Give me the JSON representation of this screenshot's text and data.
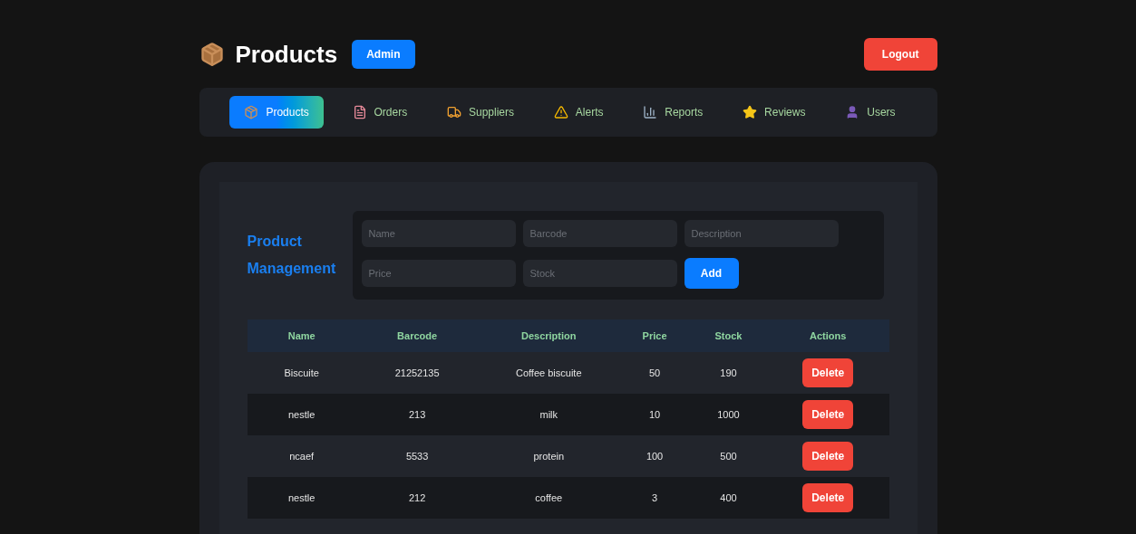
{
  "header": {
    "title": "Products",
    "role_badge": "Admin",
    "logout": "Logout"
  },
  "nav": [
    {
      "label": "Products",
      "kind": "package",
      "selected": true
    },
    {
      "label": "Orders",
      "kind": "file",
      "selected": false
    },
    {
      "label": "Suppliers",
      "kind": "truck",
      "selected": false
    },
    {
      "label": "Alerts",
      "kind": "alert",
      "selected": false
    },
    {
      "label": "Reports",
      "kind": "chart",
      "selected": false
    },
    {
      "label": "Reviews",
      "kind": "star",
      "selected": false
    },
    {
      "label": "Users",
      "kind": "user",
      "selected": false
    }
  ],
  "form": {
    "title": "Product Management",
    "fields": [
      {
        "placeholder": "Name"
      },
      {
        "placeholder": "Barcode"
      },
      {
        "placeholder": "Description"
      },
      {
        "placeholder": "Price"
      },
      {
        "placeholder": "Stock"
      }
    ],
    "submit": "Add"
  },
  "table": {
    "columns": [
      "Name",
      "Barcode",
      "Description",
      "Price",
      "Stock",
      "Actions"
    ],
    "rows": [
      {
        "cells": [
          "Biscuite",
          "21252135",
          "Coffee biscuite",
          "50",
          "190"
        ],
        "action": "Delete"
      },
      {
        "cells": [
          "nestle",
          "213",
          "milk",
          "10",
          "1000"
        ],
        "action": "Delete"
      },
      {
        "cells": [
          "ncaef",
          "5533",
          "protein",
          "100",
          "500"
        ],
        "action": "Delete"
      },
      {
        "cells": [
          "nestle",
          "212",
          "coffee",
          "3",
          "400"
        ],
        "action": "Delete"
      }
    ]
  }
}
